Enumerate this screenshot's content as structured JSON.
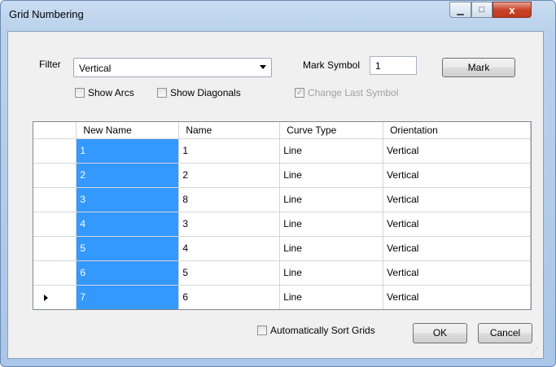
{
  "window": {
    "title": "Grid Numbering"
  },
  "controls": {
    "minimize": "▁",
    "maximize": "□",
    "close": "x"
  },
  "filter": {
    "label": "Filter",
    "selected": "Vertical"
  },
  "mark_symbol": {
    "label": "Mark Symbol",
    "value": "1"
  },
  "mark_button": "Mark",
  "show_arcs": {
    "label": "Show Arcs",
    "checked": false
  },
  "show_diagonals": {
    "label": "Show Diagonals",
    "checked": false
  },
  "change_last_symbol": {
    "label": "Change Last Symbol",
    "checked": true,
    "disabled": true
  },
  "table": {
    "columns": [
      "New Name",
      "Name",
      "Curve Type",
      "Orientation"
    ],
    "rows": [
      [
        "1",
        "1",
        "Line",
        "Vertical"
      ],
      [
        "2",
        "2",
        "Line",
        "Vertical"
      ],
      [
        "3",
        "8",
        "Line",
        "Vertical"
      ],
      [
        "4",
        "3",
        "Line",
        "Vertical"
      ],
      [
        "5",
        "4",
        "Line",
        "Vertical"
      ],
      [
        "6",
        "5",
        "Line",
        "Vertical"
      ],
      [
        "7",
        "6",
        "Line",
        "Vertical"
      ]
    ]
  },
  "auto_sort": {
    "label": "Automatically Sort Grids",
    "checked": false
  },
  "ok_button": "OK",
  "cancel_button": "Cancel"
}
